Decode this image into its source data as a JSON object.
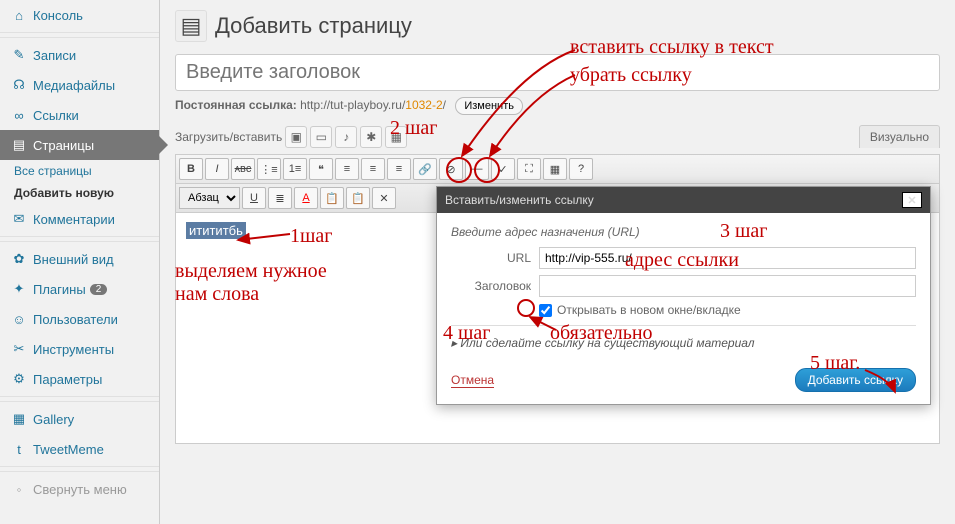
{
  "sidebar": {
    "items": [
      {
        "label": "Консоль",
        "icon": "⌂"
      },
      {
        "label": "Записи",
        "icon": "✎"
      },
      {
        "label": "Медиафайлы",
        "icon": "☊"
      },
      {
        "label": "Ссылки",
        "icon": "∞"
      },
      {
        "label": "Страницы",
        "icon": "▤"
      },
      {
        "label": "Комментарии",
        "icon": "✉"
      },
      {
        "label": "Внешний вид",
        "icon": "✿"
      },
      {
        "label": "Плагины",
        "icon": "✦",
        "badge": "2"
      },
      {
        "label": "Пользователи",
        "icon": "☺"
      },
      {
        "label": "Инструменты",
        "icon": "✂"
      },
      {
        "label": "Параметры",
        "icon": "⚙"
      },
      {
        "label": "Gallery",
        "icon": "▦"
      },
      {
        "label": "TweetMeme",
        "icon": "t"
      }
    ],
    "sub": {
      "all": "Все страницы",
      "add": "Добавить новую"
    },
    "collapse": "Свернуть меню"
  },
  "page": {
    "title": "Добавить страницу",
    "placeholder": "Введите заголовок",
    "permalink_label": "Постоянная ссылка:",
    "permalink_base": "http://tut-playboy.ru/",
    "permalink_slug": "1032-2",
    "permalink_suffix": "/",
    "edit_btn": "Изменить",
    "upload_label": "Загрузить/вставить",
    "tab_visual": "Визуально",
    "format_select": "Абзац",
    "selected_text": "итититбь"
  },
  "modal": {
    "title": "Вставить/изменить ссылку",
    "hint": "Введите адрес назначения (URL)",
    "url_label": "URL",
    "url_value": "http://vip-555.ru/",
    "title_label": "Заголовок",
    "title_value": "",
    "newtab_label": "Открывать в новом окне/вкладке",
    "expand": "Или сделайте ссылку на существующий материал",
    "cancel": "Отмена",
    "submit": "Добавить ссылку"
  },
  "annotations": {
    "step1": "1шаг",
    "select_words": "выделяем нужное\nнам слова",
    "step2": "2 шаг",
    "insert_link": "вставить ссылку в текст",
    "remove_link": "убрать ссылку",
    "step3": "3 шаг",
    "url_addr": "адрес ссылки",
    "step4": "4 шаг",
    "mandatory": "обязательно",
    "step5": "5 шаг."
  }
}
